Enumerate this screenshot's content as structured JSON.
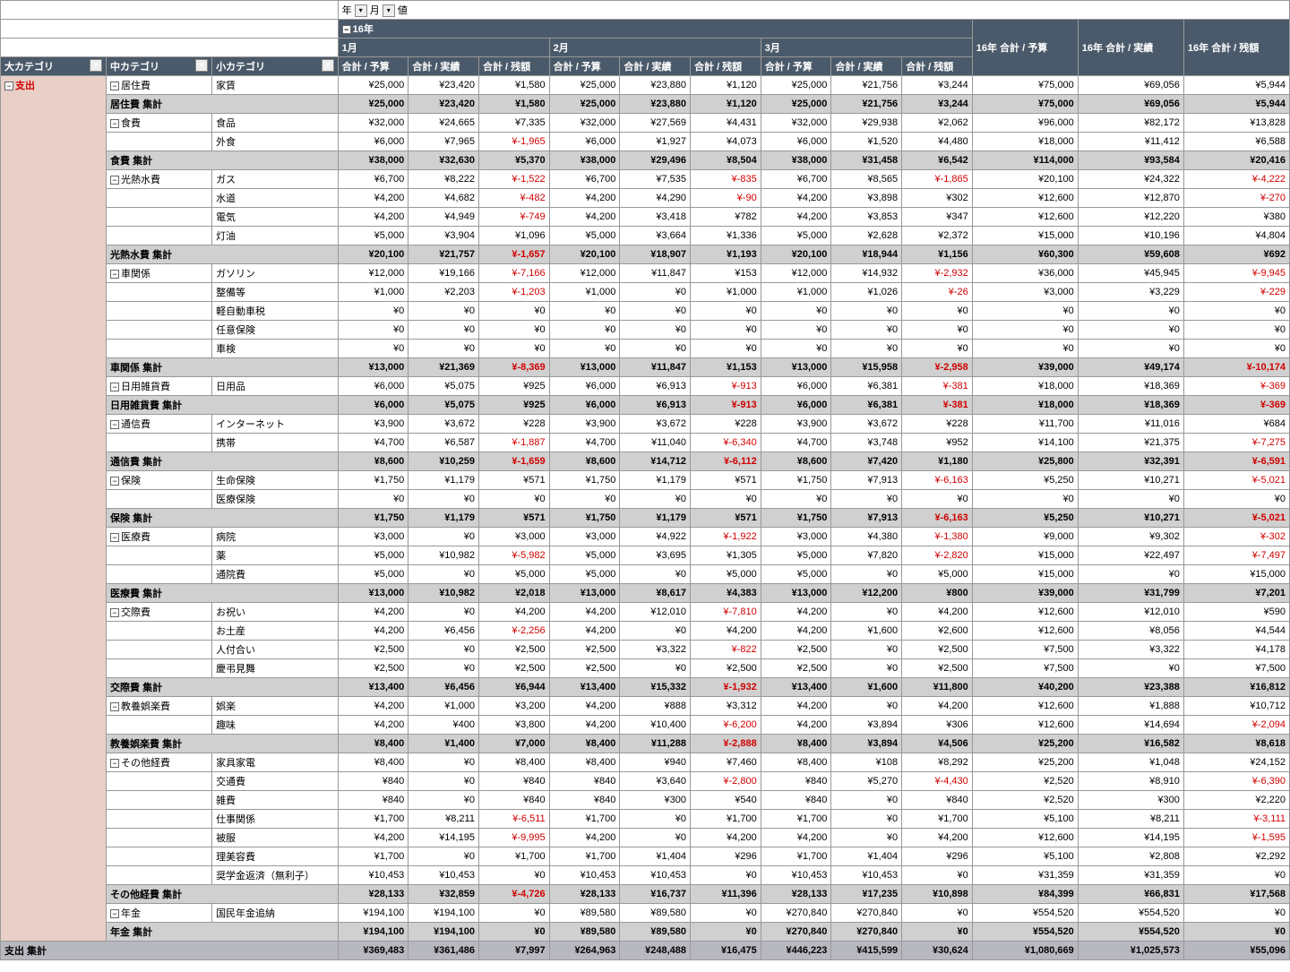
{
  "headers": {
    "year_label": "年",
    "month_label": "月",
    "value_label": "値",
    "year_expand": "16年",
    "months": [
      "1月",
      "2月",
      "3月"
    ],
    "cat_large": "大カテゴリ",
    "cat_mid": "中カテゴリ",
    "cat_small": "小カテゴリ",
    "metric_budget": "合計 / 予算",
    "metric_actual": "合計 / 実績",
    "metric_balance": "合計 / 残額",
    "year_budget": "16年 合計 / 予算",
    "year_actual": "16年 合計 / 実績",
    "year_balance": "16年 合計 / 残額"
  },
  "large_cat": "支出",
  "shisu_total_label": "支出 集計",
  "chart_data": {
    "type": "table",
    "rows": [
      {
        "mid": "居住費",
        "small": "家賃",
        "v": [
          "¥25,000",
          "¥23,420",
          "¥1,580",
          "¥25,000",
          "¥23,880",
          "¥1,120",
          "¥25,000",
          "¥21,756",
          "¥3,244",
          "¥75,000",
          "¥69,056",
          "¥5,944"
        ]
      },
      {
        "sub": "居住費 集計",
        "v": [
          "¥25,000",
          "¥23,420",
          "¥1,580",
          "¥25,000",
          "¥23,880",
          "¥1,120",
          "¥25,000",
          "¥21,756",
          "¥3,244",
          "¥75,000",
          "¥69,056",
          "¥5,944"
        ]
      },
      {
        "mid": "食費",
        "small": "食品",
        "v": [
          "¥32,000",
          "¥24,665",
          "¥7,335",
          "¥32,000",
          "¥27,569",
          "¥4,431",
          "¥32,000",
          "¥29,938",
          "¥2,062",
          "¥96,000",
          "¥82,172",
          "¥13,828"
        ]
      },
      {
        "small": "外食",
        "v": [
          "¥6,000",
          "¥7,965",
          "¥-1,965",
          "¥6,000",
          "¥1,927",
          "¥4,073",
          "¥6,000",
          "¥1,520",
          "¥4,480",
          "¥18,000",
          "¥11,412",
          "¥6,588"
        ]
      },
      {
        "sub": "食費 集計",
        "v": [
          "¥38,000",
          "¥32,630",
          "¥5,370",
          "¥38,000",
          "¥29,496",
          "¥8,504",
          "¥38,000",
          "¥31,458",
          "¥6,542",
          "¥114,000",
          "¥93,584",
          "¥20,416"
        ]
      },
      {
        "mid": "光熱水費",
        "small": "ガス",
        "v": [
          "¥6,700",
          "¥8,222",
          "¥-1,522",
          "¥6,700",
          "¥7,535",
          "¥-835",
          "¥6,700",
          "¥8,565",
          "¥-1,865",
          "¥20,100",
          "¥24,322",
          "¥-4,222"
        ]
      },
      {
        "small": "水道",
        "v": [
          "¥4,200",
          "¥4,682",
          "¥-482",
          "¥4,200",
          "¥4,290",
          "¥-90",
          "¥4,200",
          "¥3,898",
          "¥302",
          "¥12,600",
          "¥12,870",
          "¥-270"
        ]
      },
      {
        "small": "電気",
        "v": [
          "¥4,200",
          "¥4,949",
          "¥-749",
          "¥4,200",
          "¥3,418",
          "¥782",
          "¥4,200",
          "¥3,853",
          "¥347",
          "¥12,600",
          "¥12,220",
          "¥380"
        ]
      },
      {
        "small": "灯油",
        "v": [
          "¥5,000",
          "¥3,904",
          "¥1,096",
          "¥5,000",
          "¥3,664",
          "¥1,336",
          "¥5,000",
          "¥2,628",
          "¥2,372",
          "¥15,000",
          "¥10,196",
          "¥4,804"
        ]
      },
      {
        "sub": "光熱水費 集計",
        "v": [
          "¥20,100",
          "¥21,757",
          "¥-1,657",
          "¥20,100",
          "¥18,907",
          "¥1,193",
          "¥20,100",
          "¥18,944",
          "¥1,156",
          "¥60,300",
          "¥59,608",
          "¥692"
        ]
      },
      {
        "mid": "車関係",
        "small": "ガソリン",
        "v": [
          "¥12,000",
          "¥19,166",
          "¥-7,166",
          "¥12,000",
          "¥11,847",
          "¥153",
          "¥12,000",
          "¥14,932",
          "¥-2,932",
          "¥36,000",
          "¥45,945",
          "¥-9,945"
        ]
      },
      {
        "small": "整備等",
        "v": [
          "¥1,000",
          "¥2,203",
          "¥-1,203",
          "¥1,000",
          "¥0",
          "¥1,000",
          "¥1,000",
          "¥1,026",
          "¥-26",
          "¥3,000",
          "¥3,229",
          "¥-229"
        ]
      },
      {
        "small": "軽自動車税",
        "v": [
          "¥0",
          "¥0",
          "¥0",
          "¥0",
          "¥0",
          "¥0",
          "¥0",
          "¥0",
          "¥0",
          "¥0",
          "¥0",
          "¥0"
        ]
      },
      {
        "small": "任意保険",
        "v": [
          "¥0",
          "¥0",
          "¥0",
          "¥0",
          "¥0",
          "¥0",
          "¥0",
          "¥0",
          "¥0",
          "¥0",
          "¥0",
          "¥0"
        ]
      },
      {
        "small": "車検",
        "v": [
          "¥0",
          "¥0",
          "¥0",
          "¥0",
          "¥0",
          "¥0",
          "¥0",
          "¥0",
          "¥0",
          "¥0",
          "¥0",
          "¥0"
        ]
      },
      {
        "sub": "車関係 集計",
        "v": [
          "¥13,000",
          "¥21,369",
          "¥-8,369",
          "¥13,000",
          "¥11,847",
          "¥1,153",
          "¥13,000",
          "¥15,958",
          "¥-2,958",
          "¥39,000",
          "¥49,174",
          "¥-10,174"
        ]
      },
      {
        "mid": "日用雑貨費",
        "small": "日用品",
        "v": [
          "¥6,000",
          "¥5,075",
          "¥925",
          "¥6,000",
          "¥6,913",
          "¥-913",
          "¥6,000",
          "¥6,381",
          "¥-381",
          "¥18,000",
          "¥18,369",
          "¥-369"
        ]
      },
      {
        "sub": "日用雑貨費 集計",
        "v": [
          "¥6,000",
          "¥5,075",
          "¥925",
          "¥6,000",
          "¥6,913",
          "¥-913",
          "¥6,000",
          "¥6,381",
          "¥-381",
          "¥18,000",
          "¥18,369",
          "¥-369"
        ]
      },
      {
        "mid": "通信費",
        "small": "インターネット",
        "v": [
          "¥3,900",
          "¥3,672",
          "¥228",
          "¥3,900",
          "¥3,672",
          "¥228",
          "¥3,900",
          "¥3,672",
          "¥228",
          "¥11,700",
          "¥11,016",
          "¥684"
        ]
      },
      {
        "small": "携帯",
        "v": [
          "¥4,700",
          "¥6,587",
          "¥-1,887",
          "¥4,700",
          "¥11,040",
          "¥-6,340",
          "¥4,700",
          "¥3,748",
          "¥952",
          "¥14,100",
          "¥21,375",
          "¥-7,275"
        ]
      },
      {
        "sub": "通信費 集計",
        "v": [
          "¥8,600",
          "¥10,259",
          "¥-1,659",
          "¥8,600",
          "¥14,712",
          "¥-6,112",
          "¥8,600",
          "¥7,420",
          "¥1,180",
          "¥25,800",
          "¥32,391",
          "¥-6,591"
        ]
      },
      {
        "mid": "保険",
        "small": "生命保険",
        "v": [
          "¥1,750",
          "¥1,179",
          "¥571",
          "¥1,750",
          "¥1,179",
          "¥571",
          "¥1,750",
          "¥7,913",
          "¥-6,163",
          "¥5,250",
          "¥10,271",
          "¥-5,021"
        ]
      },
      {
        "small": "医療保険",
        "v": [
          "¥0",
          "¥0",
          "¥0",
          "¥0",
          "¥0",
          "¥0",
          "¥0",
          "¥0",
          "¥0",
          "¥0",
          "¥0",
          "¥0"
        ]
      },
      {
        "sub": "保険 集計",
        "v": [
          "¥1,750",
          "¥1,179",
          "¥571",
          "¥1,750",
          "¥1,179",
          "¥571",
          "¥1,750",
          "¥7,913",
          "¥-6,163",
          "¥5,250",
          "¥10,271",
          "¥-5,021"
        ]
      },
      {
        "mid": "医療費",
        "small": "病院",
        "v": [
          "¥3,000",
          "¥0",
          "¥3,000",
          "¥3,000",
          "¥4,922",
          "¥-1,922",
          "¥3,000",
          "¥4,380",
          "¥-1,380",
          "¥9,000",
          "¥9,302",
          "¥-302"
        ]
      },
      {
        "small": "薬",
        "v": [
          "¥5,000",
          "¥10,982",
          "¥-5,982",
          "¥5,000",
          "¥3,695",
          "¥1,305",
          "¥5,000",
          "¥7,820",
          "¥-2,820",
          "¥15,000",
          "¥22,497",
          "¥-7,497"
        ]
      },
      {
        "small": "通院費",
        "v": [
          "¥5,000",
          "¥0",
          "¥5,000",
          "¥5,000",
          "¥0",
          "¥5,000",
          "¥5,000",
          "¥0",
          "¥5,000",
          "¥15,000",
          "¥0",
          "¥15,000"
        ]
      },
      {
        "sub": "医療費 集計",
        "v": [
          "¥13,000",
          "¥10,982",
          "¥2,018",
          "¥13,000",
          "¥8,617",
          "¥4,383",
          "¥13,000",
          "¥12,200",
          "¥800",
          "¥39,000",
          "¥31,799",
          "¥7,201"
        ]
      },
      {
        "mid": "交際費",
        "small": "お祝い",
        "v": [
          "¥4,200",
          "¥0",
          "¥4,200",
          "¥4,200",
          "¥12,010",
          "¥-7,810",
          "¥4,200",
          "¥0",
          "¥4,200",
          "¥12,600",
          "¥12,010",
          "¥590"
        ]
      },
      {
        "small": "お土産",
        "v": [
          "¥4,200",
          "¥6,456",
          "¥-2,256",
          "¥4,200",
          "¥0",
          "¥4,200",
          "¥4,200",
          "¥1,600",
          "¥2,600",
          "¥12,600",
          "¥8,056",
          "¥4,544"
        ]
      },
      {
        "small": "人付合い",
        "v": [
          "¥2,500",
          "¥0",
          "¥2,500",
          "¥2,500",
          "¥3,322",
          "¥-822",
          "¥2,500",
          "¥0",
          "¥2,500",
          "¥7,500",
          "¥3,322",
          "¥4,178"
        ]
      },
      {
        "small": "慶弔見舞",
        "v": [
          "¥2,500",
          "¥0",
          "¥2,500",
          "¥2,500",
          "¥0",
          "¥2,500",
          "¥2,500",
          "¥0",
          "¥2,500",
          "¥7,500",
          "¥0",
          "¥7,500"
        ]
      },
      {
        "sub": "交際費 集計",
        "v": [
          "¥13,400",
          "¥6,456",
          "¥6,944",
          "¥13,400",
          "¥15,332",
          "¥-1,932",
          "¥13,400",
          "¥1,600",
          "¥11,800",
          "¥40,200",
          "¥23,388",
          "¥16,812"
        ]
      },
      {
        "mid": "教養娯楽費",
        "small": "娯楽",
        "v": [
          "¥4,200",
          "¥1,000",
          "¥3,200",
          "¥4,200",
          "¥888",
          "¥3,312",
          "¥4,200",
          "¥0",
          "¥4,200",
          "¥12,600",
          "¥1,888",
          "¥10,712"
        ]
      },
      {
        "small": "趣味",
        "v": [
          "¥4,200",
          "¥400",
          "¥3,800",
          "¥4,200",
          "¥10,400",
          "¥-6,200",
          "¥4,200",
          "¥3,894",
          "¥306",
          "¥12,600",
          "¥14,694",
          "¥-2,094"
        ]
      },
      {
        "sub": "教養娯楽費 集計",
        "v": [
          "¥8,400",
          "¥1,400",
          "¥7,000",
          "¥8,400",
          "¥11,288",
          "¥-2,888",
          "¥8,400",
          "¥3,894",
          "¥4,506",
          "¥25,200",
          "¥16,582",
          "¥8,618"
        ]
      },
      {
        "mid": "その他経費",
        "small": "家具家電",
        "v": [
          "¥8,400",
          "¥0",
          "¥8,400",
          "¥8,400",
          "¥940",
          "¥7,460",
          "¥8,400",
          "¥108",
          "¥8,292",
          "¥25,200",
          "¥1,048",
          "¥24,152"
        ]
      },
      {
        "small": "交通費",
        "v": [
          "¥840",
          "¥0",
          "¥840",
          "¥840",
          "¥3,640",
          "¥-2,800",
          "¥840",
          "¥5,270",
          "¥-4,430",
          "¥2,520",
          "¥8,910",
          "¥-6,390"
        ]
      },
      {
        "small": "雑費",
        "v": [
          "¥840",
          "¥0",
          "¥840",
          "¥840",
          "¥300",
          "¥540",
          "¥840",
          "¥0",
          "¥840",
          "¥2,520",
          "¥300",
          "¥2,220"
        ]
      },
      {
        "small": "仕事関係",
        "v": [
          "¥1,700",
          "¥8,211",
          "¥-6,511",
          "¥1,700",
          "¥0",
          "¥1,700",
          "¥1,700",
          "¥0",
          "¥1,700",
          "¥5,100",
          "¥8,211",
          "¥-3,111"
        ]
      },
      {
        "small": "被服",
        "v": [
          "¥4,200",
          "¥14,195",
          "¥-9,995",
          "¥4,200",
          "¥0",
          "¥4,200",
          "¥4,200",
          "¥0",
          "¥4,200",
          "¥12,600",
          "¥14,195",
          "¥-1,595"
        ]
      },
      {
        "small": "理美容費",
        "v": [
          "¥1,700",
          "¥0",
          "¥1,700",
          "¥1,700",
          "¥1,404",
          "¥296",
          "¥1,700",
          "¥1,404",
          "¥296",
          "¥5,100",
          "¥2,808",
          "¥2,292"
        ]
      },
      {
        "small": "奨学金返済（無利子）",
        "v": [
          "¥10,453",
          "¥10,453",
          "¥0",
          "¥10,453",
          "¥10,453",
          "¥0",
          "¥10,453",
          "¥10,453",
          "¥0",
          "¥31,359",
          "¥31,359",
          "¥0"
        ]
      },
      {
        "sub": "その他経費 集計",
        "v": [
          "¥28,133",
          "¥32,859",
          "¥-4,726",
          "¥28,133",
          "¥16,737",
          "¥11,396",
          "¥28,133",
          "¥17,235",
          "¥10,898",
          "¥84,399",
          "¥66,831",
          "¥17,568"
        ]
      },
      {
        "mid": "年金",
        "small": "国民年金追納",
        "v": [
          "¥194,100",
          "¥194,100",
          "¥0",
          "¥89,580",
          "¥89,580",
          "¥0",
          "¥270,840",
          "¥270,840",
          "¥0",
          "¥554,520",
          "¥554,520",
          "¥0"
        ]
      },
      {
        "sub": "年金 集計",
        "v": [
          "¥194,100",
          "¥194,100",
          "¥0",
          "¥89,580",
          "¥89,580",
          "¥0",
          "¥270,840",
          "¥270,840",
          "¥0",
          "¥554,520",
          "¥554,520",
          "¥0"
        ]
      }
    ],
    "grand": [
      "¥369,483",
      "¥361,486",
      "¥7,997",
      "¥264,963",
      "¥248,488",
      "¥16,475",
      "¥446,223",
      "¥415,599",
      "¥30,624",
      "¥1,080,669",
      "¥1,025,573",
      "¥55,096"
    ]
  }
}
